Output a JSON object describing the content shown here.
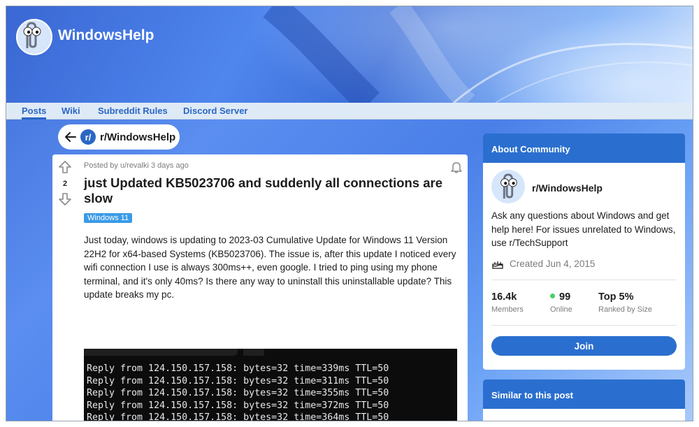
{
  "site": {
    "title": "WindowsHelp",
    "logo_icon": "clippy-icon"
  },
  "nav": {
    "items": [
      {
        "label": "Posts",
        "active": true
      },
      {
        "label": "Wiki",
        "active": false
      },
      {
        "label": "Subreddit Rules",
        "active": false
      },
      {
        "label": "Discord Server",
        "active": false
      }
    ]
  },
  "back": {
    "sub_badge": "r/",
    "label": "r/WindowsHelp"
  },
  "post": {
    "votes": "2",
    "meta": "Posted by u/revalki 3 days ago",
    "title": "just Updated KB5023706 and suddenly all connections are slow",
    "flair": "Windows 11",
    "body": "Just today, windows is updating to 2023-03 Cumulative Update for Windows 11 Version 22H2 for x64-based Systems (KB5023706). The issue is, after this update I noticed every wifi connection I use is always 300ms++, even google. I tried to ping using my phone terminal, and it's only 40ms? Is there any way to uninstall this uninstallable update? This update breaks my pc.",
    "terminal_lines": [
      "Reply from 124.150.157.158: bytes=32 time=339ms TTL=50",
      "Reply from 124.150.157.158: bytes=32 time=311ms TTL=50",
      "Reply from 124.150.157.158: bytes=32 time=355ms TTL=50",
      "Reply from 124.150.157.158: bytes=32 time=372ms TTL=50",
      "Reply from 124.150.157.158: bytes=32 time=364ms TTL=50"
    ]
  },
  "about": {
    "header": "About Community",
    "name": "r/WindowsHelp",
    "description": "Ask any questions about Windows and get help here! For issues unrelated to Windows, use r/TechSupport",
    "created": "Created Jun 4, 2015",
    "stats": {
      "members_value": "16.4k",
      "members_label": "Members",
      "online_value": "99",
      "online_label": "Online",
      "rank_value": "Top 5%",
      "rank_label": "Ranked by Size"
    },
    "join_label": "Join"
  },
  "similar": {
    "header": "Similar to this post"
  },
  "colors": {
    "accent": "#2a6fcf",
    "nav_text": "#2a66c4",
    "flair": "#3a9be6",
    "online": "#46d160"
  }
}
